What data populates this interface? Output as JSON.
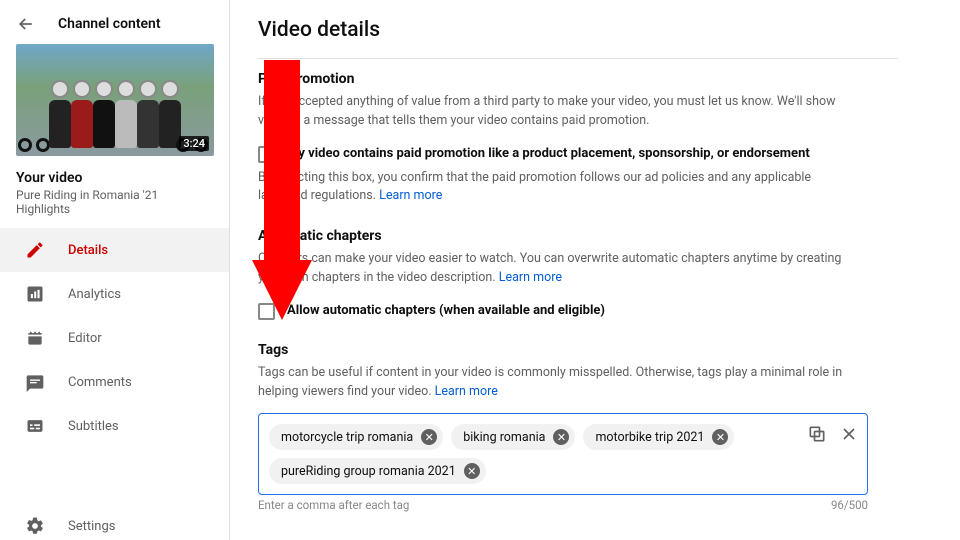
{
  "sidebar": {
    "header": "Channel content",
    "thumbnail_duration": "3:24",
    "your_video_label": "Your video",
    "video_title": "Pure Riding in Romania '21 Highlights",
    "items": [
      {
        "label": "Details",
        "icon": "pencil-icon",
        "active": true
      },
      {
        "label": "Analytics",
        "icon": "chart-icon",
        "active": false
      },
      {
        "label": "Editor",
        "icon": "clapper-icon",
        "active": false
      },
      {
        "label": "Comments",
        "icon": "comment-icon",
        "active": false
      },
      {
        "label": "Subtitles",
        "icon": "subtitle-icon",
        "active": false
      }
    ],
    "settings_label": "Settings"
  },
  "page": {
    "title": "Video details"
  },
  "paid_promotion": {
    "heading": "Paid promotion",
    "body": "If you accepted anything of value from a third party to make your video, you must let us know. We'll show viewers a message that tells them your video contains paid promotion.",
    "checkbox_label": "My video contains paid promotion like a product placement, sponsorship, or endorsement",
    "sub_body_pre": "By selecting this box, you confirm that the paid promotion follows our ad policies and any applicable laws and regulations. ",
    "learn_more": "Learn more"
  },
  "chapters": {
    "heading": "Automatic chapters",
    "body_pre": "Chapters can make your video easier to watch. You can overwrite automatic chapters anytime by creating your own chapters in the video description. ",
    "learn_more": "Learn more",
    "checkbox_label": "Allow automatic chapters (when available and eligible)"
  },
  "tags": {
    "heading": "Tags",
    "body_pre": "Tags can be useful if content in your video is commonly misspelled. Otherwise, tags play a minimal role in helping viewers find your video. ",
    "learn_more": "Learn more",
    "chips": [
      "motorcycle trip romania",
      "biking romania",
      "motorbike trip 2021",
      "pureRiding group romania 2021"
    ],
    "hint": "Enter a comma after each tag",
    "counter": "96/500"
  },
  "annotation": {
    "arrow_color": "#ff0000"
  }
}
